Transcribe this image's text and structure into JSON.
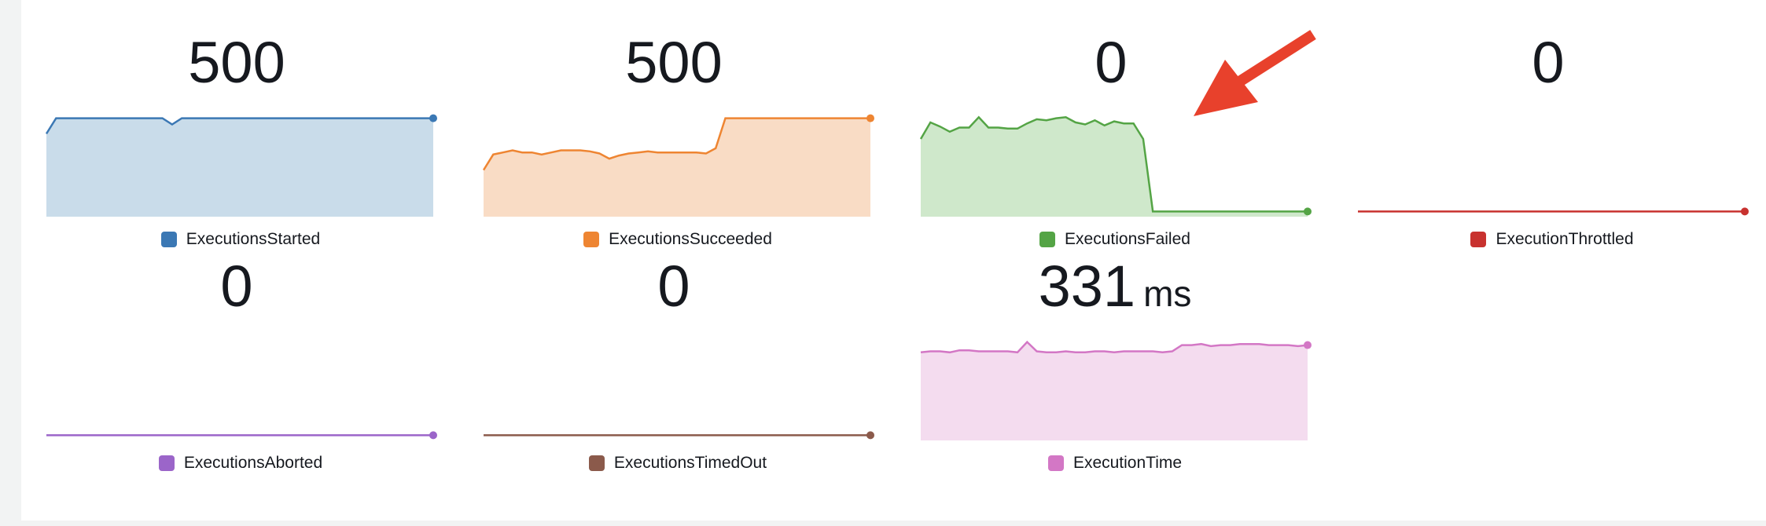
{
  "widgets": [
    {
      "key": "started",
      "value": "500",
      "unit": "",
      "label": "ExecutionsStarted",
      "color": "#3b78b4",
      "fill": "#c9dcea",
      "series": [
        20,
        5,
        5,
        5,
        5,
        5,
        5,
        5,
        5,
        5,
        5,
        5,
        5,
        11,
        5,
        5,
        5,
        5,
        5,
        5,
        5,
        5,
        5,
        5,
        5,
        5,
        5,
        5,
        5,
        5,
        5,
        5,
        5,
        5,
        5,
        5,
        5,
        5,
        5,
        5,
        5
      ]
    },
    {
      "key": "succeeded",
      "value": "500",
      "unit": "",
      "label": "ExecutionsSucceeded",
      "color": "#ee8532",
      "fill": "#f9dcc5",
      "series": [
        55,
        40,
        38,
        36,
        38,
        38,
        40,
        38,
        36,
        36,
        36,
        37,
        39,
        44,
        41,
        39,
        38,
        37,
        38,
        38,
        38,
        38,
        38,
        39,
        34,
        5,
        5,
        5,
        5,
        5,
        5,
        5,
        5,
        5,
        5,
        5,
        5,
        5,
        5,
        5,
        5
      ]
    },
    {
      "key": "failed",
      "value": "0",
      "unit": "",
      "label": "ExecutionsFailed",
      "color": "#54a445",
      "fill": "#cfe8cb",
      "series": [
        25,
        9,
        13,
        18,
        14,
        14,
        4,
        14,
        14,
        15,
        15,
        10,
        6,
        7,
        5,
        4,
        9,
        11,
        7,
        12,
        8,
        10,
        10,
        25,
        95,
        95,
        95,
        95,
        95,
        95,
        95,
        95,
        95,
        95,
        95,
        95,
        95,
        95,
        95,
        95,
        95
      ]
    },
    {
      "key": "throttled",
      "value": "0",
      "unit": "",
      "label": "ExecutionThrottled",
      "color": "#c8322f",
      "fill": "none",
      "series": [
        95,
        95,
        95,
        95,
        95,
        95,
        95,
        95,
        95,
        95,
        95,
        95,
        95,
        95,
        95,
        95,
        95,
        95,
        95,
        95,
        95,
        95,
        95,
        95,
        95,
        95,
        95,
        95,
        95,
        95,
        95,
        95,
        95,
        95,
        95,
        95,
        95,
        95,
        95,
        95,
        95
      ]
    },
    {
      "key": "aborted",
      "value": "0",
      "unit": "",
      "label": "ExecutionsAborted",
      "color": "#9b65c9",
      "fill": "none",
      "series": [
        95,
        95,
        95,
        95,
        95,
        95,
        95,
        95,
        95,
        95,
        95,
        95,
        95,
        95,
        95,
        95,
        95,
        95,
        95,
        95,
        95,
        95,
        95,
        95,
        95,
        95,
        95,
        95,
        95,
        95,
        95,
        95,
        95,
        95,
        95,
        95,
        95,
        95,
        95,
        95,
        95
      ]
    },
    {
      "key": "timedout",
      "value": "0",
      "unit": "",
      "label": "ExecutionsTimedOut",
      "color": "#8b5a4b",
      "fill": "none",
      "series": [
        95,
        95,
        95,
        95,
        95,
        95,
        95,
        95,
        95,
        95,
        95,
        95,
        95,
        95,
        95,
        95,
        95,
        95,
        95,
        95,
        95,
        95,
        95,
        95,
        95,
        95,
        95,
        95,
        95,
        95,
        95,
        95,
        95,
        95,
        95,
        95,
        95,
        95,
        95,
        95,
        95
      ]
    },
    {
      "key": "exectime",
      "value": "331",
      "unit": "ms",
      "label": "ExecutionTime",
      "color": "#d377c5",
      "fill": "#f4dcef",
      "series": [
        15,
        14,
        14,
        15,
        13,
        13,
        14,
        14,
        14,
        14,
        15,
        5,
        14,
        15,
        15,
        14,
        15,
        15,
        14,
        14,
        15,
        14,
        14,
        14,
        14,
        15,
        14,
        8,
        8,
        7,
        9,
        8,
        8,
        7,
        7,
        7,
        8,
        8,
        8,
        9,
        8
      ]
    }
  ],
  "annotation": {
    "color": "#e8412c"
  }
}
